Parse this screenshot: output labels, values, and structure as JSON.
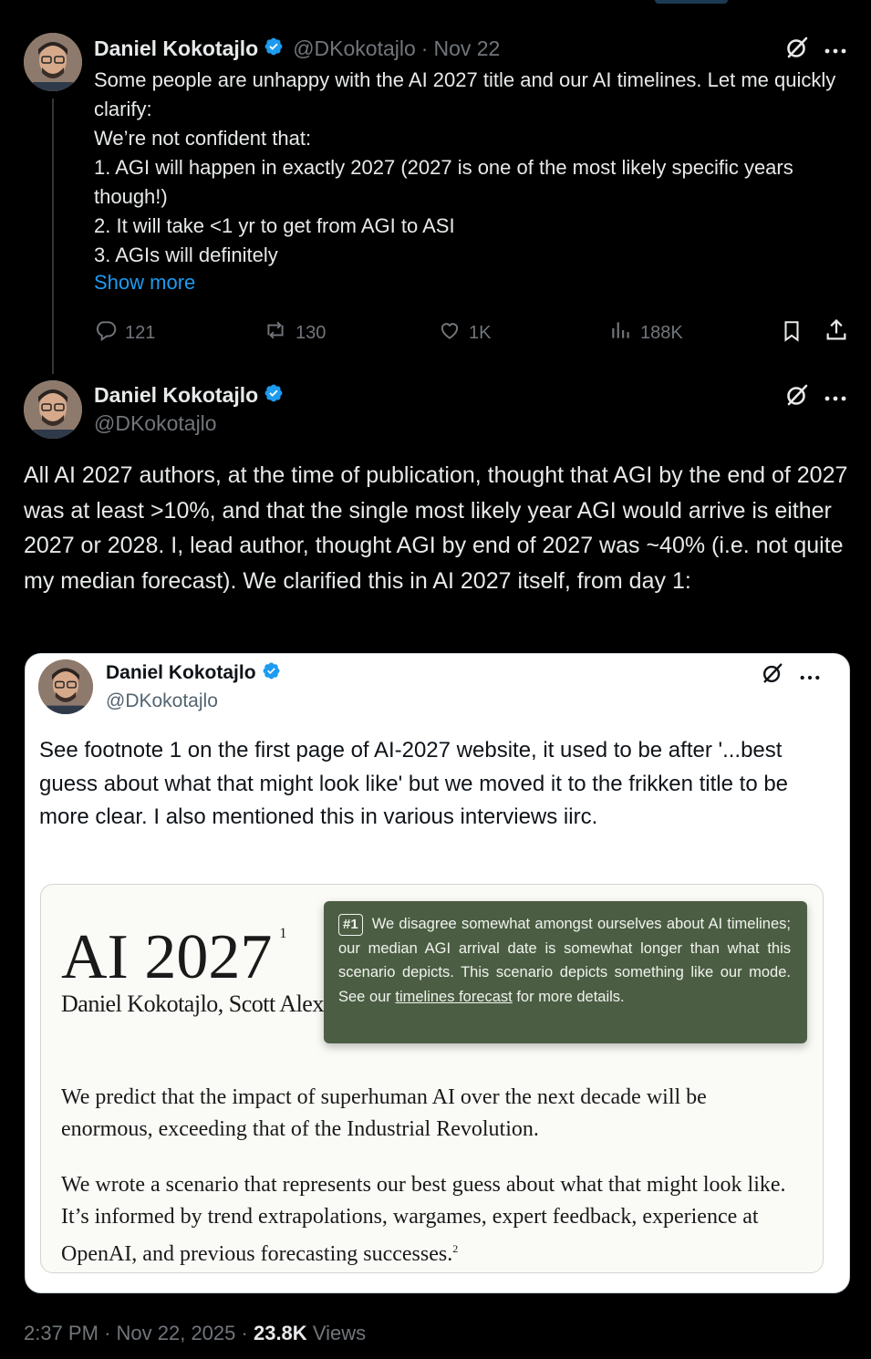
{
  "parent_tweet": {
    "author_name": "Daniel Kokotajlo",
    "handle": "@DKokotajlo",
    "separator": "·",
    "date": "Nov 22",
    "text": "Some people are unhappy with the AI 2027 title and our AI timelines. Let me quickly clarify:\nWe’re not confident that:\n1. AGI will happen in exactly 2027 (2027 is one of the most likely specific years though!)\n2. It will take <1 yr to get from AGI to ASI\n3. AGIs will definitely",
    "show_more": "Show more",
    "replies": "121",
    "reposts": "130",
    "likes": "1K",
    "views": "188K"
  },
  "main_tweet": {
    "author_name": "Daniel Kokotajlo",
    "handle": "@DKokotajlo",
    "text": "All AI 2027 authors, at the time of publication, thought that AGI by the end of 2027 was at least >10%, and that the single most likely year AGI would arrive is either 2027 or 2028. I, lead author, thought AGI by end of 2027 was ~40% (i.e. not quite my median forecast). We clarified this in AI 2027 itself, from day 1:",
    "time": "2:37 PM",
    "date": "Nov 22, 2025",
    "views_count": "23.8K",
    "views_label": "Views",
    "separator": "·"
  },
  "quoted_tweet": {
    "author_name": "Daniel Kokotajlo",
    "handle": "@DKokotajlo",
    "text": "See footnote 1 on the first page of AI-2027 website, it used to be after '...best guess about what that might look like' but we moved it to the frikken title to be more clear. I also mentioned this in various interviews iirc."
  },
  "screenshot": {
    "title": "AI 2027",
    "title_sup": "1",
    "authors": "Daniel Kokotajlo, Scott Alex",
    "tooltip_badge": "#1",
    "tooltip_text_before": "We disagree somewhat amongst ourselves about AI timelines; our median AGI arrival date is somewhat longer than what this scenario depicts. This scenario depicts something like our mode. See our ",
    "tooltip_link": "timelines forecast",
    "tooltip_text_after": " for more details.",
    "para1": "We predict that the impact of superhuman AI over the next decade will be enormous, exceeding that of the Industrial Revolution.",
    "para2": "We wrote a scenario that represents our best guess about what that might look like. It’s informed by trend extrapolations, wargames, expert feedback, experience at OpenAI, and previous forecasting successes.",
    "para2_sup": "2"
  },
  "icons": [
    "grok-icon",
    "more-icon",
    "reply-icon",
    "repost-icon",
    "like-icon",
    "views-icon",
    "bookmark-icon",
    "share-icon",
    "verified-icon"
  ],
  "colors": {
    "background": "#000000",
    "link": "#1d9bf0",
    "verified": "#1d9bf0",
    "tooltip": "#4b5e43",
    "muted": "#71767b"
  }
}
